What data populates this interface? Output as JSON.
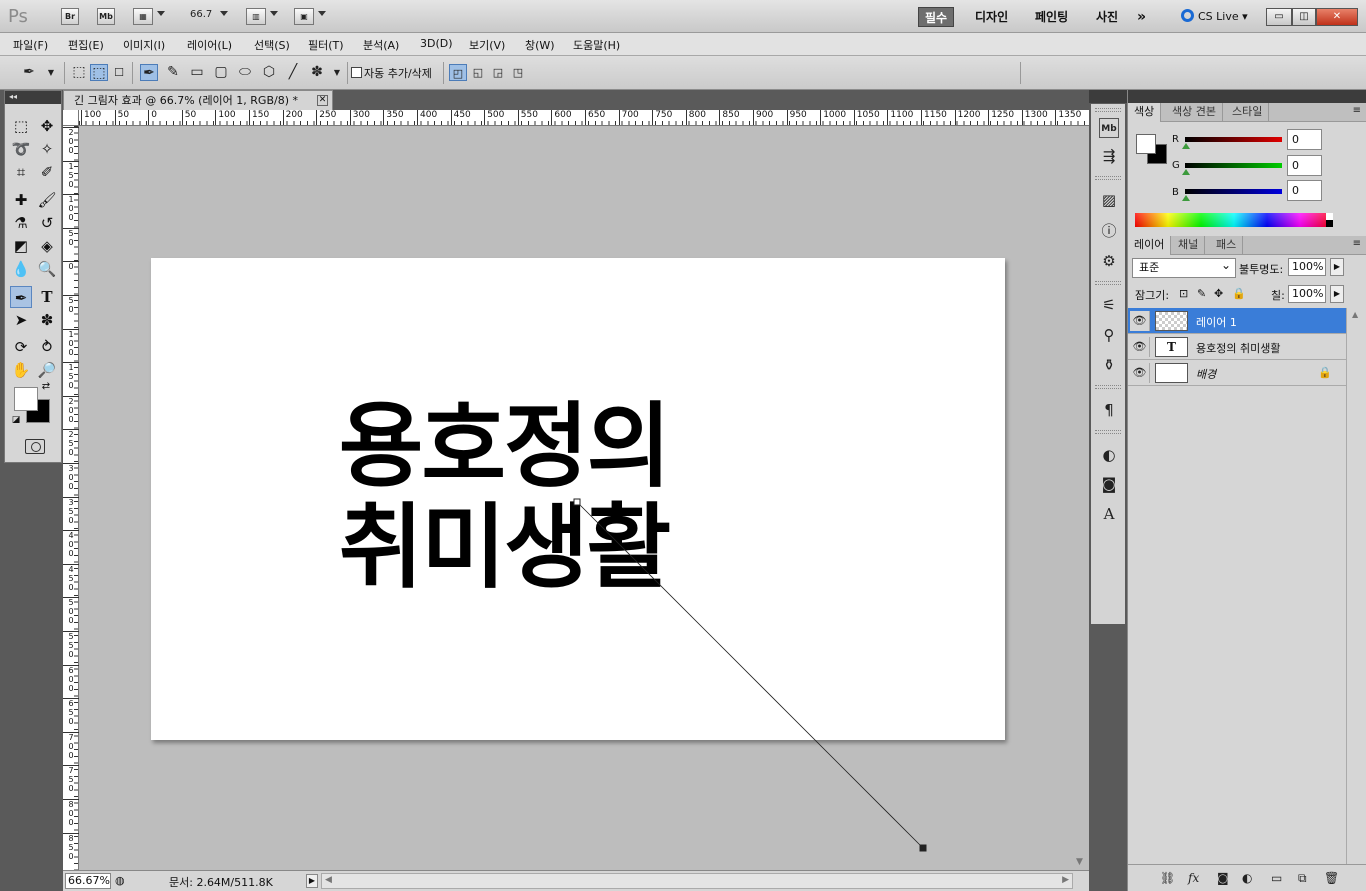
{
  "app": {
    "logo": "Ps",
    "bridge_label": "Br",
    "minibridge_label": "Mb",
    "zoom_value": "66.7",
    "workspaces": [
      "필수",
      "디자인",
      "페인팅",
      "사진"
    ],
    "more": "»",
    "cs_live": "CS Live",
    "win_min": "▭",
    "win_restore": "◫",
    "win_close": "✕"
  },
  "menu": [
    "파일(F)",
    "편집(E)",
    "이미지(I)",
    "레이어(L)",
    "선택(S)",
    "필터(T)",
    "분석(A)",
    "3D(D)",
    "보기(V)",
    "창(W)",
    "도움말(H)"
  ],
  "options": {
    "auto_add_delete": "자동 추가/삭제",
    "auto_add_delete_checked": false
  },
  "document": {
    "tab_title": "긴 그림자 효과 @ 66.7% (레이어 1, RGB/8) *",
    "canvas_line1": "용호정의",
    "canvas_line2": "취미생활",
    "ruler_h": [
      "100",
      "50",
      "0",
      "50",
      "100",
      "150",
      "200",
      "250",
      "300",
      "350",
      "400",
      "450",
      "500",
      "550",
      "600",
      "650",
      "700",
      "750",
      "800",
      "850",
      "900",
      "950",
      "1000",
      "1050",
      "1100",
      "1150",
      "1200",
      "1250",
      "1300",
      "1350"
    ],
    "ruler_v": [
      "2\n0\n0",
      "1\n5\n0",
      "1\n0\n0",
      "5\n0",
      "0",
      "5\n0",
      "1\n0\n0",
      "1\n5\n0",
      "2\n0\n0",
      "2\n5\n0",
      "3\n0\n0",
      "3\n5\n0",
      "4\n0\n0",
      "4\n5\n0",
      "5\n0\n0",
      "5\n5\n0",
      "6\n0\n0",
      "6\n5\n0",
      "7\n0\n0",
      "7\n5\n0",
      "8\n0\n0",
      "8\n5\n0"
    ]
  },
  "status": {
    "zoom": "66.67%",
    "doc_info": "문서: 2.64M/511.8K"
  },
  "color_panel": {
    "tabs": [
      "색상",
      "색상 견본",
      "스타일"
    ],
    "channels": [
      {
        "label": "R",
        "value": "0",
        "color": "#e00000"
      },
      {
        "label": "G",
        "value": "0",
        "color": "#00cc00"
      },
      {
        "label": "B",
        "value": "0",
        "color": "#0000dd"
      }
    ]
  },
  "layers_panel": {
    "tabs": [
      "레이어",
      "채널",
      "패스"
    ],
    "blend_mode": "표준",
    "opacity_label": "불투명도:",
    "opacity_value": "100%",
    "lock_label": "잠그기:",
    "fill_label": "칠:",
    "fill_value": "100%",
    "layers": [
      {
        "name": "레이어 1",
        "type": "pixel",
        "selected": true
      },
      {
        "name": "용호정의 취미생활",
        "type": "text",
        "selected": false
      },
      {
        "name": "배경",
        "type": "background",
        "selected": false
      }
    ],
    "text_thumb": "T"
  },
  "colors": {
    "selection_blue": "#3a7dd8",
    "panel_gray": "#d6d6d6",
    "pasteboard": "#bdbdbd"
  }
}
